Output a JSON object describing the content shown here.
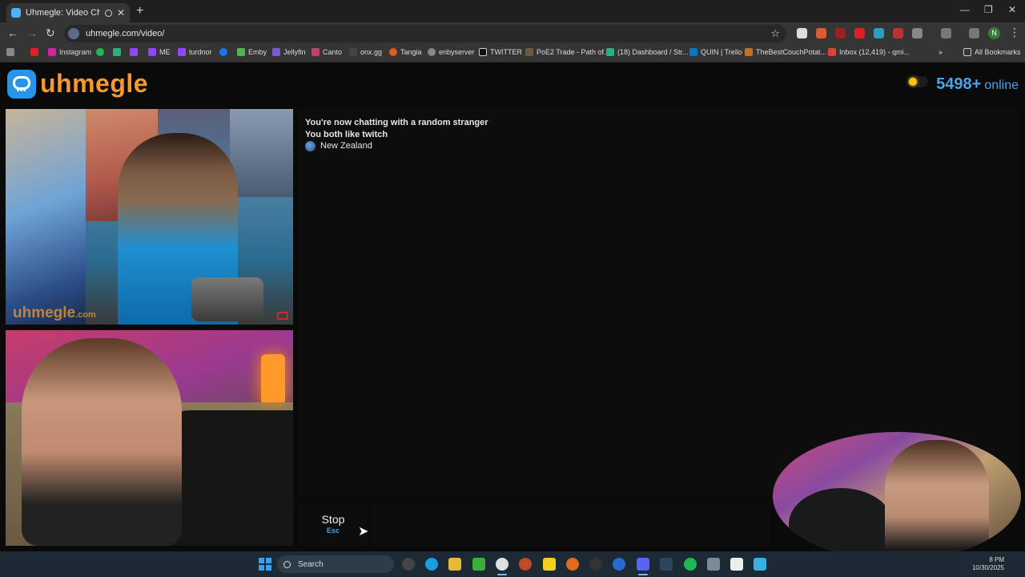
{
  "browser": {
    "tab_title": "Uhmegle: Video Chat | Ran",
    "new_tab_icon": "plus-icon",
    "url": "uhmegle.com/video/",
    "bookmarks": [
      "Instagram",
      "ME",
      "turdnor",
      "Emby",
      "Jellyfin",
      "Canto",
      "onx.gg",
      "Tangia",
      "enbyserver",
      "TWITTER",
      "PoE2 Trade - Path of...",
      "(18) Dashboard / Str...",
      "QUIN | Trello",
      "TheBestCouchPotat...",
      "Inbox (12,419) - qmi..."
    ],
    "all_bookmarks": "All Bookmarks",
    "profile_initial": "N"
  },
  "site": {
    "logo_text": "uhmegle",
    "online_count": "5498+",
    "online_label": "online",
    "watermark_main": "uhmegle",
    "watermark_suffix": ".com"
  },
  "chat": {
    "lines": [
      "You're now chatting with a random stranger",
      "You both like twitch"
    ],
    "location": "New Zealand"
  },
  "controls": {
    "stop_label": "Stop",
    "stop_hint": "Esc",
    "input_value": ""
  },
  "taskbar": {
    "search_label": "Search",
    "clock_time": "8 PM",
    "clock_date": "10/30/2025"
  },
  "colors": {
    "accent_orange": "#f29a2e",
    "accent_blue": "#4aa3e8",
    "logo_blue": "#2795e9"
  }
}
